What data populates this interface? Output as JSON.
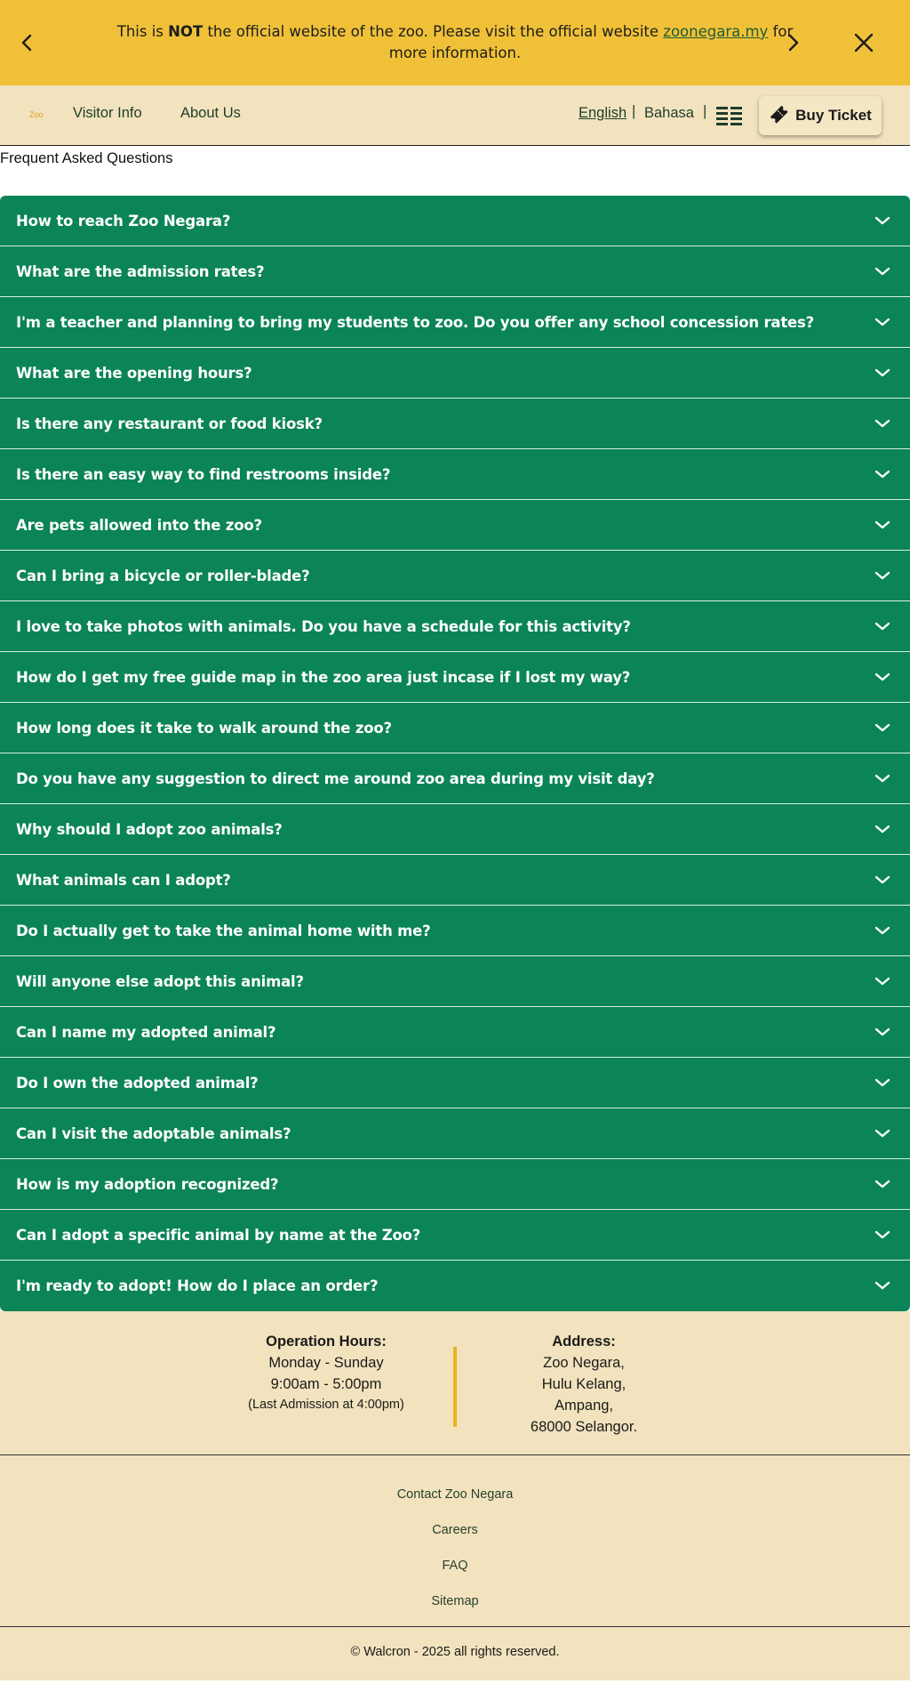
{
  "notice": {
    "prefix": "This is ",
    "emphasis": "NOT",
    "middle": " the official website of the zoo. Please visit the official website ",
    "link_text": "zoonegara.my",
    "suffix": " for more information."
  },
  "header": {
    "logo_text": "Zoo",
    "nav": [
      "Visitor Info",
      "About Us"
    ],
    "languages": [
      "English",
      "Bahasa"
    ],
    "separator": "|",
    "buy_ticket": "Buy Ticket"
  },
  "faq": {
    "heading": "Frequent Asked Questions",
    "questions": [
      "How to reach Zoo Negara?",
      "What are the admission rates?",
      "I'm a teacher and planning to bring my students to zoo. Do you offer any school concession rates?",
      "What are the opening hours?",
      "Is there any restaurant or food kiosk?",
      "Is there an easy way to find restrooms inside?",
      "Are pets allowed into the zoo?",
      "Can I bring a bicycle or roller-blade?",
      "I love to take photos with animals. Do you have a schedule for this activity?",
      "How do I get my free guide map in the zoo area just incase if I lost my way?",
      "How long does it take to walk around the zoo?",
      "Do you have any suggestion to direct me around zoo area during my visit day?",
      "Why should I adopt zoo animals?",
      "What animals can I adopt?",
      "Do I actually get to take the animal home with me?",
      "Will anyone else adopt this animal?",
      "Can I name my adopted animal?",
      "Do I own the adopted animal?",
      "Can I visit the adoptable animals?",
      "How is my adoption recognized?",
      "Can I adopt a specific animal by name at the Zoo?",
      "I'm ready to adopt! How do I place an order?"
    ]
  },
  "info": {
    "hours_title": "Operation Hours:",
    "hours_days": "Monday - Sunday",
    "hours_time": "9:00am - 5:00pm",
    "hours_note": "(Last Admission at 4:00pm)",
    "address_title": "Address:",
    "address_lines": [
      "Zoo Negara,",
      "Hulu Kelang,",
      "Ampang,",
      "68000 Selangor."
    ]
  },
  "footer": {
    "links": [
      "Contact Zoo Negara",
      "Careers",
      "FAQ",
      "Sitemap"
    ],
    "copyright": "© Walcron - 2025 all rights reserved."
  },
  "colors": {
    "banner": "#f0c138",
    "header_bg": "#f2e3be",
    "faq_green": "#0b8457",
    "divider_gold": "#e9b21f"
  },
  "icons": [
    "chevron-left-icon",
    "chevron-right-icon",
    "close-icon",
    "menu-grid-icon",
    "ticket-icon",
    "chevron-down-icon"
  ]
}
